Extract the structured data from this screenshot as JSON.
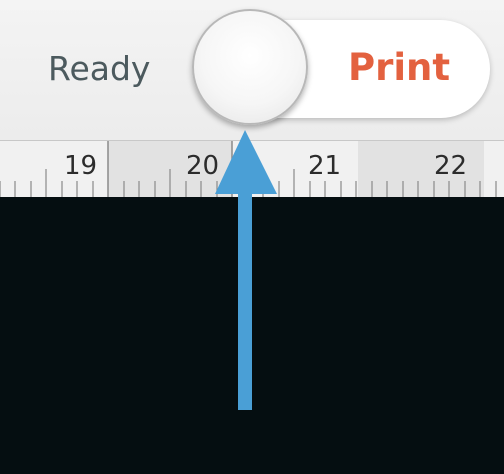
{
  "toolbar": {
    "status_label": "Ready",
    "action_label": "Print",
    "action_color": "#e3613f",
    "status_color": "#4c5a5e",
    "toggle_on": false
  },
  "ruler": {
    "labels": [
      "19",
      "20",
      "21",
      "22"
    ]
  },
  "annotation": {
    "icon": "up-arrow-icon",
    "color": "#4a9fd6"
  },
  "canvas": {
    "background": "#050e11"
  }
}
